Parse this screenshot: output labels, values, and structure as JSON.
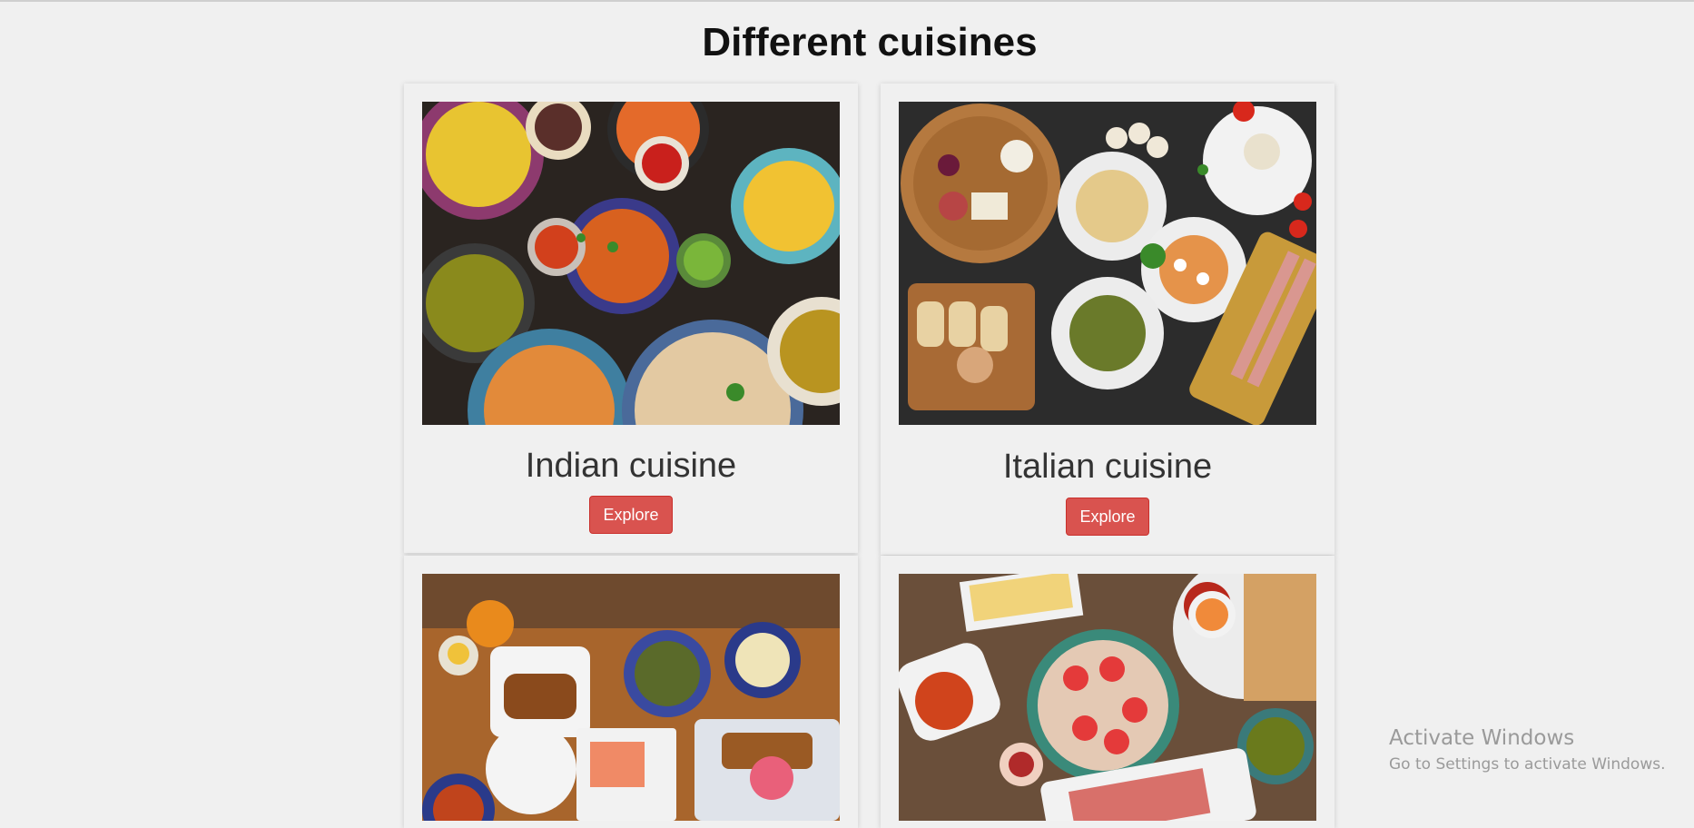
{
  "page": {
    "title": "Different cuisines"
  },
  "cards": [
    {
      "name": "Indian cuisine",
      "button_label": "Explore"
    },
    {
      "name": "Italian cuisine",
      "button_label": "Explore"
    },
    {
      "name": "",
      "button_label": ""
    },
    {
      "name": "",
      "button_label": ""
    }
  ],
  "watermark": {
    "line1": "Activate Windows",
    "line2": "Go to Settings to activate Windows."
  },
  "colors": {
    "background": "#f0f0f0",
    "button": "#d9534f",
    "button_text": "#ffffff"
  }
}
